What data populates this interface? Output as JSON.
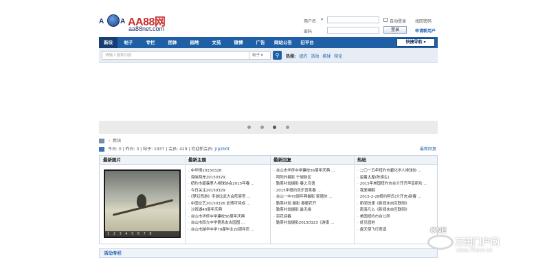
{
  "header": {
    "logo_prefix": "A",
    "logo_prefix2": "A",
    "brand": "AA88网",
    "domain": "aa88net.com"
  },
  "login": {
    "username_label": "用户名",
    "username_dropdown": "▾",
    "password_label": "密码",
    "auto_login_label": "自动登录",
    "forgot_label": "找回密码",
    "login_button": "登录",
    "register_link": "申请新用户"
  },
  "nav": {
    "items": [
      "新块",
      "帖子",
      "专栏",
      "团体",
      "园地",
      "文苑",
      "微博",
      "广告",
      "网站公告",
      "旧平台"
    ],
    "quick_nav": "快捷导航 ▾"
  },
  "search": {
    "placeholder": "请输入搜索内容",
    "scope": "帖子 ▾",
    "go_icon": "search-icon",
    "hot_label": "热搜:",
    "hot_keywords": [
      "纽约",
      "活动",
      "排球",
      "辩论"
    ]
  },
  "slider": {
    "dots_active_index": 2
  },
  "breadcrumb": {
    "current": "新块"
  },
  "stats": {
    "today": "今日: 0",
    "yesterday": "昨日: 3",
    "posts": "帖子: 1937",
    "members": "会员: 429",
    "welcome": "欢迎新会员:",
    "new_member": "jrp2b0t",
    "right_link": "最新回复"
  },
  "columns": {
    "headers": [
      "最新图片",
      "最新主题",
      "最新回复",
      "热帖"
    ],
    "photo_pager": "1 2 3 4 5 6 7 8",
    "latest_topics": [
      "中华情20150328",
      "海峡两岸20150329",
      "纽约市碧森摩人排球协会2015年春 ...",
      "今日关注20150329",
      "《梦幻西游》手游比武大会阵容官 ...",
      "中国交艺20150326 此情可待成 ...",
      "沙西湖40周年庆典",
      "台山市华侨中学建校56周年庆典",
      "台山市四九中学第系友古园图 ...",
      "台山市越华中学79届毕业20周年庆 ..."
    ],
    "latest_replies": [
      "台山市华侨中学建校56周年庆典 ...",
      "阿阳外摄影 宁城新区",
      "勤菜补翁摄影 春之鸟语",
      "2015年纽约凤乐宫系春 ...",
      "台山一中70周年典摄影 家德的 ...",
      "勤菜补翁 摄影 春暖花开",
      "勤菜补翁摄影 最无缘",
      "百花迎春",
      "勤菜补翁摄影20150323《游南 ..."
    ],
    "hot_posts": [
      "二〇一五年纽约市碧化华人排球协 ...",
      "留着太屋(陈焕生)",
      "2015年美国纽约市台分开开声音新欢 ...",
      "我爱睡眠",
      "2015-2-28纽约阿氏(分开言)新春 ...",
      "新闻快递《新闻未自互联网》",
      "南海凡么《新闻未自互联网》",
      "美国纽约市台公所",
      "虾见园地",
      "盘天使飞行表演"
    ]
  },
  "footer_bar": {
    "label": "活动专栏"
  },
  "watermark": {
    "one": "ONE",
    "text": "万田门户网",
    "url": "www.75one.cn"
  }
}
